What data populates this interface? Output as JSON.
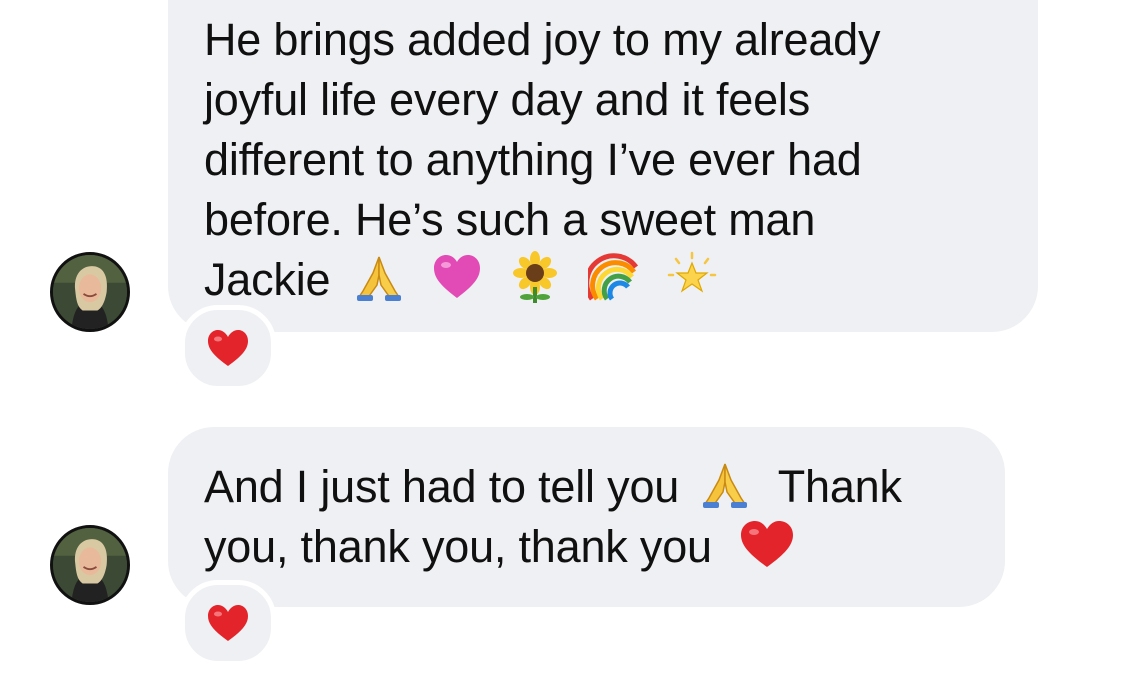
{
  "messages": [
    {
      "lines": [
        "He brings added joy to my already",
        "joyful life every day and it feels",
        "different to anything I’ve ever had",
        "before. He’s such a sweet man",
        "Jackie"
      ],
      "trailing_emojis": [
        "folded-hands",
        "pink-heart",
        "sunflower",
        "rainbow",
        "glowing-star"
      ],
      "reaction": "red-heart"
    },
    {
      "line1_text": "And I just had to tell you",
      "line1_emoji": "folded-hands",
      "line1_after": "Thank",
      "line2_text": "you, thank you, thank you",
      "line2_emoji": "red-heart",
      "reaction": "red-heart"
    }
  ],
  "colors": {
    "bubble": "#eff0f3",
    "text": "#101010",
    "reaction_heart": "#e3242b",
    "pink_heart": "#e24bb5"
  }
}
